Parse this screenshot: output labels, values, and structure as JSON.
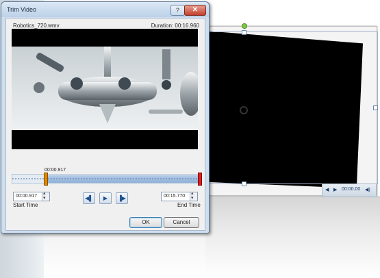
{
  "dialog": {
    "title": "Trim Video",
    "help_icon": "help-icon",
    "close_icon": "close-icon",
    "file_name": "Robotics_720.wmv",
    "duration_label": "Duration:",
    "duration_value": "00:16.960",
    "current_time": "00:00.917",
    "start_time_value": "00:00.917",
    "end_time_value": "00:15.770",
    "start_time_label": "Start Time",
    "end_time_label": "End Time",
    "previous_frame_icon": "previous-frame-icon",
    "play_icon": "play-icon",
    "next_frame_icon": "next-frame-icon",
    "ok_label": "OK",
    "cancel_label": "Cancel",
    "trim_start_fraction": 0.054,
    "trim_end_fraction": 0.93
  },
  "slide": {
    "player_time": "00:00.00",
    "play_icon": "play-icon",
    "back_icon": "rewind-icon",
    "volume_icon": "volume-icon"
  },
  "colors": {
    "accent": "#1d4f8f",
    "start_marker": "#e08a00",
    "end_marker": "#dd2222"
  }
}
